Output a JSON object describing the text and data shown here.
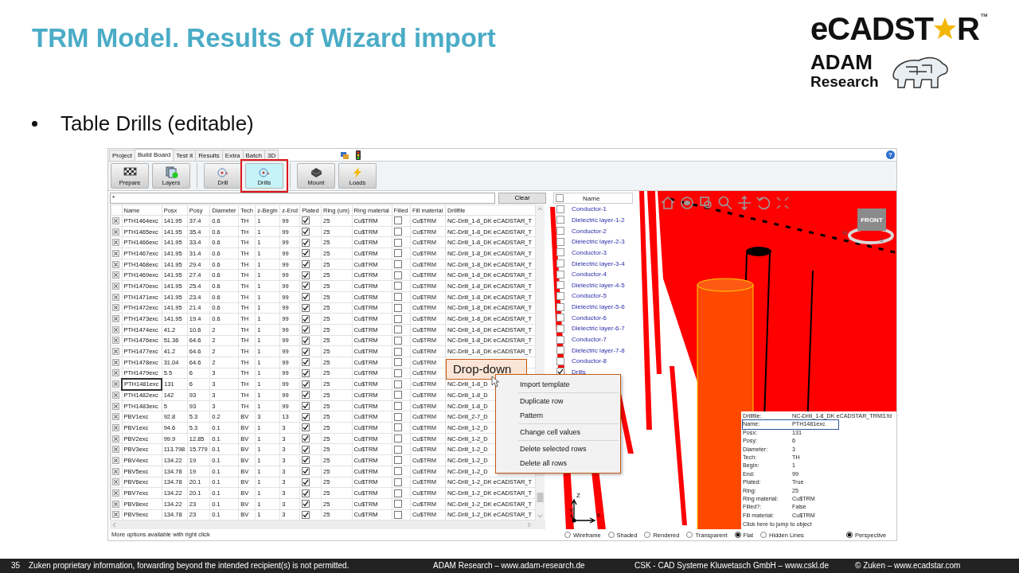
{
  "slide": {
    "title": "TRM Model. Results of Wizard import",
    "bullet_text": "Table Drills (editable)"
  },
  "logo": {
    "brand_start": "eCADST",
    "brand_end": "R",
    "trademark": "™",
    "company": "ADAM",
    "company_line_2": "Research"
  },
  "app": {
    "tabs": [
      {
        "label": "Project",
        "selected": false
      },
      {
        "label": "Build Board",
        "selected": true
      },
      {
        "label": "Test it",
        "selected": false
      },
      {
        "label": "Results",
        "selected": false
      },
      {
        "label": "Extra",
        "selected": false
      },
      {
        "label": "Batch",
        "selected": false
      },
      {
        "label": "3D",
        "selected": false
      }
    ],
    "help": "?",
    "toolbar": [
      {
        "buttons": [
          {
            "label": "Prepare",
            "selected": false,
            "highlighted": false
          },
          {
            "label": "Layers",
            "selected": false,
            "highlighted": false
          }
        ]
      },
      {
        "buttons": [
          {
            "label": "Drill",
            "selected": false,
            "highlighted": false
          },
          {
            "label": "Drills",
            "selected": true,
            "highlighted": true
          }
        ]
      },
      {
        "buttons": [
          {
            "label": "Mount",
            "selected": false,
            "highlighted": false
          },
          {
            "label": "Loads",
            "selected": false,
            "highlighted": false
          }
        ]
      }
    ],
    "filter": {
      "value": "*"
    },
    "clear_button": "Clear",
    "table": {
      "columns": [
        {
          "label": "Name",
          "kind": "text"
        },
        {
          "label": "Posx",
          "kind": "text"
        },
        {
          "label": "Posy",
          "kind": "text"
        },
        {
          "label": "Diameter",
          "kind": "text"
        },
        {
          "label": "Tech",
          "kind": "text"
        },
        {
          "label": "z-Begin",
          "kind": "text"
        },
        {
          "label": "z-End",
          "kind": "text"
        },
        {
          "label": "Plated",
          "kind": "check"
        },
        {
          "label": "Ring (um)",
          "kind": "text"
        },
        {
          "label": "Ring material",
          "kind": "text"
        },
        {
          "label": "Filled",
          "kind": "check"
        },
        {
          "label": "Fill material",
          "kind": "text"
        },
        {
          "label": "Drillfile",
          "kind": "text"
        }
      ],
      "rows": [
        {
          "focused": false,
          "cells": [
            "PTH1464exc",
            "141.95",
            "37.4",
            "0.6",
            "TH",
            "1",
            "99",
            true,
            "25",
            "Cu$TRM",
            false,
            "Cu$TRM",
            "NC-Drill_1-8_DK eCADSTAR_T"
          ]
        },
        {
          "focused": false,
          "cells": [
            "PTH1465exc",
            "141.95",
            "35.4",
            "0.6",
            "TH",
            "1",
            "99",
            true,
            "25",
            "Cu$TRM",
            false,
            "Cu$TRM",
            "NC-Drill_1-8_DK eCADSTAR_T"
          ]
        },
        {
          "focused": false,
          "cells": [
            "PTH1466exc",
            "141.95",
            "33.4",
            "0.6",
            "TH",
            "1",
            "99",
            true,
            "25",
            "Cu$TRM",
            false,
            "Cu$TRM",
            "NC-Drill_1-8_DK eCADSTAR_T"
          ]
        },
        {
          "focused": false,
          "cells": [
            "PTH1467exc",
            "141.95",
            "31.4",
            "0.6",
            "TH",
            "1",
            "99",
            true,
            "25",
            "Cu$TRM",
            false,
            "Cu$TRM",
            "NC-Drill_1-8_DK eCADSTAR_T"
          ]
        },
        {
          "focused": false,
          "cells": [
            "PTH1468exc",
            "141.95",
            "29.4",
            "0.6",
            "TH",
            "1",
            "99",
            true,
            "25",
            "Cu$TRM",
            false,
            "Cu$TRM",
            "NC-Drill_1-8_DK eCADSTAR_T"
          ]
        },
        {
          "focused": false,
          "cells": [
            "PTH1469exc",
            "141.95",
            "27.4",
            "0.6",
            "TH",
            "1",
            "99",
            true,
            "25",
            "Cu$TRM",
            false,
            "Cu$TRM",
            "NC-Drill_1-8_DK eCADSTAR_T"
          ]
        },
        {
          "focused": false,
          "cells": [
            "PTH1470exc",
            "141.95",
            "25.4",
            "0.6",
            "TH",
            "1",
            "99",
            true,
            "25",
            "Cu$TRM",
            false,
            "Cu$TRM",
            "NC-Drill_1-8_DK eCADSTAR_T"
          ]
        },
        {
          "focused": false,
          "cells": [
            "PTH1471exc",
            "141.95",
            "23.4",
            "0.6",
            "TH",
            "1",
            "99",
            true,
            "25",
            "Cu$TRM",
            false,
            "Cu$TRM",
            "NC-Drill_1-8_DK eCADSTAR_T"
          ]
        },
        {
          "focused": false,
          "cells": [
            "PTH1472exc",
            "141.95",
            "21.4",
            "0.6",
            "TH",
            "1",
            "99",
            true,
            "25",
            "Cu$TRM",
            false,
            "Cu$TRM",
            "NC-Drill_1-8_DK eCADSTAR_T"
          ]
        },
        {
          "focused": false,
          "cells": [
            "PTH1473exc",
            "141.95",
            "19.4",
            "0.6",
            "TH",
            "1",
            "99",
            true,
            "25",
            "Cu$TRM",
            false,
            "Cu$TRM",
            "NC-Drill_1-8_DK eCADSTAR_T"
          ]
        },
        {
          "focused": false,
          "cells": [
            "PTH1474exc",
            "41.2",
            "10.6",
            "2",
            "TH",
            "1",
            "99",
            true,
            "25",
            "Cu$TRM",
            false,
            "Cu$TRM",
            "NC-Drill_1-8_DK eCADSTAR_T"
          ]
        },
        {
          "focused": false,
          "cells": [
            "PTH1476exc",
            "51.36",
            "64.6",
            "2",
            "TH",
            "1",
            "99",
            true,
            "25",
            "Cu$TRM",
            false,
            "Cu$TRM",
            "NC-Drill_1-8_DK eCADSTAR_T"
          ]
        },
        {
          "focused": false,
          "cells": [
            "PTH1477exc",
            "41.2",
            "64.6",
            "2",
            "TH",
            "1",
            "99",
            true,
            "25",
            "Cu$TRM",
            false,
            "Cu$TRM",
            "NC-Drill_1-8_DK eCADSTAR_T"
          ]
        },
        {
          "focused": false,
          "cells": [
            "PTH1478exc",
            "31.04",
            "64.6",
            "2",
            "TH",
            "1",
            "99",
            true,
            "25",
            "Cu$TRM",
            false,
            "Cu$TRM"
          ]
        },
        {
          "focused": false,
          "cells": [
            "PTH1479exc",
            "5.5",
            "6",
            "3",
            "TH",
            "1",
            "99",
            true,
            "25",
            "Cu$TRM",
            false,
            "Cu$TRM"
          ]
        },
        {
          "focused": true,
          "cells": [
            "PTH1481exc",
            "131",
            "6",
            "3",
            "TH",
            "1",
            "99",
            true,
            "25",
            "Cu$TRM",
            false,
            "Cu$TRM",
            "NC-Drill_1-8_D"
          ]
        },
        {
          "focused": false,
          "cells": [
            "PTH1482exc",
            "142",
            "93",
            "3",
            "TH",
            "1",
            "99",
            true,
            "25",
            "Cu$TRM",
            false,
            "Cu$TRM",
            "NC-Drill_1-8_D"
          ]
        },
        {
          "focused": false,
          "cells": [
            "PTH1483exc",
            "5",
            "93",
            "3",
            "TH",
            "1",
            "99",
            true,
            "25",
            "Cu$TRM",
            false,
            "Cu$TRM",
            "NC-Drill_1-8_D"
          ]
        },
        {
          "focused": false,
          "cells": [
            "PBV1exc",
            "92.8",
            "5.3",
            "0.2",
            "BV",
            "3",
            "13",
            true,
            "25",
            "Cu$TRM",
            false,
            "Cu$TRM",
            "NC-Drill_2-7_D"
          ]
        },
        {
          "focused": false,
          "cells": [
            "PBV1exc",
            "94.6",
            "5.3",
            "0.1",
            "BV",
            "1",
            "3",
            true,
            "25",
            "Cu$TRM",
            false,
            "Cu$TRM",
            "NC-Drill_1-2_D"
          ]
        },
        {
          "focused": false,
          "cells": [
            "PBV2exc",
            "99.9",
            "12.85",
            "0.1",
            "BV",
            "1",
            "3",
            true,
            "25",
            "Cu$TRM",
            false,
            "Cu$TRM",
            "NC-Drill_1-2_D"
          ]
        },
        {
          "focused": false,
          "cells": [
            "PBV3exc",
            "113.798",
            "15.779",
            "0.1",
            "BV",
            "1",
            "3",
            true,
            "25",
            "Cu$TRM",
            false,
            "Cu$TRM",
            "NC-Drill_1-2_D"
          ]
        },
        {
          "focused": false,
          "cells": [
            "PBV4exc",
            "134.22",
            "19",
            "0.1",
            "BV",
            "1",
            "3",
            true,
            "25",
            "Cu$TRM",
            false,
            "Cu$TRM",
            "NC-Drill_1-2_D"
          ]
        },
        {
          "focused": false,
          "cells": [
            "PBV5exc",
            "134.78",
            "19",
            "0.1",
            "BV",
            "1",
            "3",
            true,
            "25",
            "Cu$TRM",
            false,
            "Cu$TRM",
            "NC-Drill_1-2_D"
          ]
        },
        {
          "focused": false,
          "cells": [
            "PBV6exc",
            "134.78",
            "20.1",
            "0.1",
            "BV",
            "1",
            "3",
            true,
            "25",
            "Cu$TRM",
            false,
            "Cu$TRM",
            "NC-Drill_1-2_DK eCADSTAR_T"
          ]
        },
        {
          "focused": false,
          "cells": [
            "PBV7exc",
            "134.22",
            "20.1",
            "0.1",
            "BV",
            "1",
            "3",
            true,
            "25",
            "Cu$TRM",
            false,
            "Cu$TRM",
            "NC-Drill_1-2_DK eCADSTAR_T"
          ]
        },
        {
          "focused": false,
          "cells": [
            "PBV8exc",
            "134.22",
            "23",
            "0.1",
            "BV",
            "1",
            "3",
            true,
            "25",
            "Cu$TRM",
            false,
            "Cu$TRM",
            "NC-Drill_1-2_DK eCADSTAR_T"
          ]
        },
        {
          "focused": false,
          "cells": [
            "PBV9exc",
            "134.78",
            "23",
            "0.1",
            "BV",
            "1",
            "3",
            true,
            "25",
            "Cu$TRM",
            false,
            "Cu$TRM",
            "NC-Drill_1-2_DK eCADSTAR_T"
          ]
        }
      ]
    },
    "status": "More options available with right click",
    "layers": {
      "header": "Name",
      "header_checked": false,
      "items": [
        {
          "name": "Conductor-1",
          "checked": false
        },
        {
          "name": "Dielectric layer-1-2",
          "checked": false
        },
        {
          "name": "Conductor-2",
          "checked": false
        },
        {
          "name": "Dielectric layer-2-3",
          "checked": false
        },
        {
          "name": "Conductor-3",
          "checked": false
        },
        {
          "name": "Dielectric layer-3-4",
          "checked": false
        },
        {
          "name": "Conductor-4",
          "checked": false
        },
        {
          "name": "Dielectric layer-4-5",
          "checked": false
        },
        {
          "name": "Conductor-5",
          "checked": false
        },
        {
          "name": "Dielectric layer-5-6",
          "checked": false
        },
        {
          "name": "Conductor-6",
          "checked": false
        },
        {
          "name": "Dielectric layer-6-7",
          "checked": false
        },
        {
          "name": "Conductor-7",
          "checked": false
        },
        {
          "name": "Dielectric layer-7-8",
          "checked": false
        },
        {
          "name": "Conductor-8",
          "checked": false
        },
        {
          "name": "Drills",
          "checked": true
        }
      ]
    },
    "view_cube": {
      "face": "FRONT",
      "compass": [
        "W",
        "S"
      ]
    },
    "axes": [
      "Z",
      "Y",
      "X"
    ],
    "tooltip": {
      "rows": [
        {
          "key": "Drillfile:",
          "value": "NC-Drill_1-8_DK eCADSTAR_TRM3.fd",
          "highlighted": false
        },
        {
          "key": "Name:",
          "value": "PTH1481exc",
          "highlighted": true
        },
        {
          "key": "Posx:",
          "value": "131",
          "highlighted": false
        },
        {
          "key": "Posy:",
          "value": "6",
          "highlighted": false
        },
        {
          "key": "Diameter:",
          "value": "3",
          "highlighted": false
        },
        {
          "key": "Tech:",
          "value": "TH",
          "highlighted": false
        },
        {
          "key": "Begin:",
          "value": "1",
          "highlighted": false
        },
        {
          "key": "End:",
          "value": "99",
          "highlighted": false
        },
        {
          "key": "Plated:",
          "value": "True",
          "highlighted": false
        },
        {
          "key": "Ring:",
          "value": "25",
          "highlighted": false
        },
        {
          "key": "Ring material:",
          "value": "Cu$TRM",
          "highlighted": false
        },
        {
          "key": "Filled?:",
          "value": "False",
          "highlighted": false
        },
        {
          "key": "Fill material:",
          "value": "Cu$TRM",
          "highlighted": false
        }
      ],
      "link": "Click here to jump to object"
    },
    "render_modes": [
      {
        "label": "Wireframe",
        "selected": false
      },
      {
        "label": "Shaded",
        "selected": false
      },
      {
        "label": "Rendered",
        "selected": false
      },
      {
        "label": "Transparent",
        "selected": false
      },
      {
        "label": "Flat",
        "selected": true
      },
      {
        "label": "Hidden Lines",
        "selected": false
      }
    ],
    "projection": [
      {
        "label": "Perspective",
        "selected": true
      }
    ]
  },
  "callout": {
    "text": "Drop-down"
  },
  "context_menu": {
    "groups": [
      [
        "Import template"
      ],
      [
        "Duplicate row",
        "Pattern"
      ],
      [
        "Change cell values"
      ],
      [
        "Delete selected rows",
        "Delete all rows"
      ]
    ]
  },
  "footer": {
    "page": "35",
    "notes": [
      "Zuken proprietary information, forwarding beyond the intended recipient(s) is not permitted.",
      "ADAM Research – www.adam-research.de",
      "CSK - CAD Systeme Kluwetasch GmbH – www.cskl.de",
      "© Zuken – www.ecadstar.com"
    ]
  }
}
